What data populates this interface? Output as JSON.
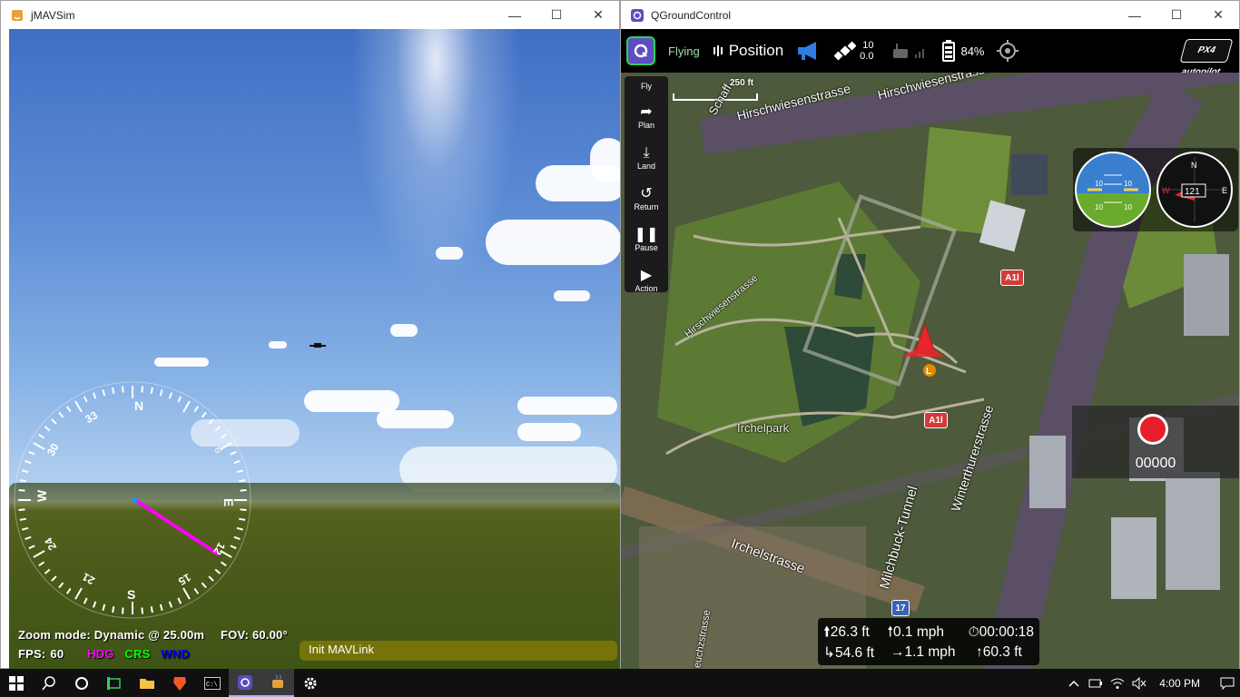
{
  "jmavsim": {
    "title": "jMAVSim",
    "hud": {
      "compass_labels": [
        "N",
        "E",
        "S",
        "W",
        "33",
        "30",
        "24",
        "21",
        "15",
        "12",
        "6"
      ],
      "zoom_text": "Zoom mode: Dynamic @ 25.00m",
      "fov_text": "FOV: 60.00°",
      "fps_label": "FPS:",
      "fps_value": "60",
      "hdg": "HDG",
      "crs": "CRS",
      "wnd": "WND",
      "mavlink_status": "Init MAVLink"
    },
    "colors": {
      "hdg": "#ff00ff",
      "crs": "#00ff00",
      "wnd": "#0000ff"
    }
  },
  "qgc": {
    "title": "QGroundControl",
    "toolbar": {
      "vehicle_state": "Flying",
      "flight_mode": "Position",
      "gps_count": "10",
      "gps_hdop": "0.0",
      "battery": "84%",
      "brand": "PX4 autopilot"
    },
    "tools": [
      {
        "label": "Fly",
        "icon": ""
      },
      {
        "label": "Plan",
        "icon": "plan-icon"
      },
      {
        "label": "Land",
        "icon": "land-icon"
      },
      {
        "label": "Return",
        "icon": "return-icon"
      },
      {
        "label": "Pause",
        "icon": "pause-icon"
      },
      {
        "label": "Action",
        "icon": "play-icon"
      }
    ],
    "map": {
      "scale": "250 ft",
      "labels": [
        "Hirschwiesenstrasse",
        "Hirschwiesenstrasse",
        "Hirschwiesenstrasse",
        "Irchelpark",
        "Milchbuck-Tunnel",
        "Winterthurerstrasse",
        "Irchelstrasse",
        "Schaff",
        "euchzstrasse"
      ],
      "shields": [
        "A1l",
        "A1l",
        "17"
      ],
      "home_marker": "L"
    },
    "instruments": {
      "heading": "121",
      "compass_letters": [
        "N",
        "E",
        "W"
      ],
      "attitude_ticks": [
        "10",
        "10",
        "10",
        "10"
      ]
    },
    "camera": {
      "counter": "00000"
    },
    "telemetry": {
      "altitude": "26.3 ft",
      "vertical_speed": "0.1 mph",
      "flight_time": "00:00:18",
      "distance": "54.6 ft",
      "ground_speed": "1.1 mph",
      "distance_home": "60.3 ft"
    }
  },
  "taskbar": {
    "clock": "4:00 PM"
  }
}
